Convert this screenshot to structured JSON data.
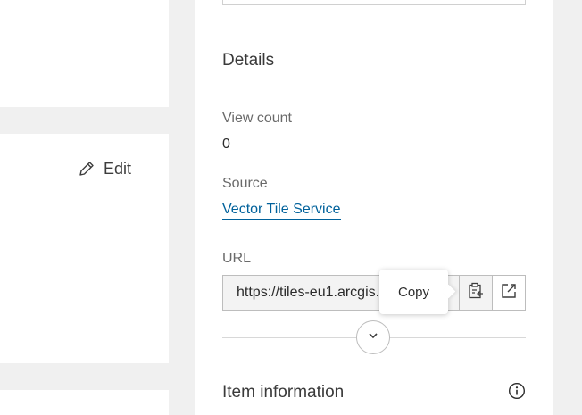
{
  "left": {
    "edit_label": "Edit",
    "icons": {
      "edit": "pencil-icon"
    }
  },
  "details": {
    "title": "Details",
    "view_count_label": "View count",
    "view_count_value": "0",
    "source_label": "Source",
    "source_value": "Vector Tile Service",
    "url_label": "URL",
    "url_value": "https://tiles-eu1.arcgis.com",
    "copy_tooltip": "Copy",
    "icons": {
      "copy": "clipboard-copy-icon",
      "open": "external-link-icon",
      "expand": "chevron-down-icon"
    }
  },
  "item_information": {
    "title": "Item information",
    "icons": {
      "info": "info-icon"
    }
  },
  "colors": {
    "link": "#00619b",
    "background": "#f0f0f0",
    "card": "#ffffff",
    "border": "#bdbdbd"
  }
}
